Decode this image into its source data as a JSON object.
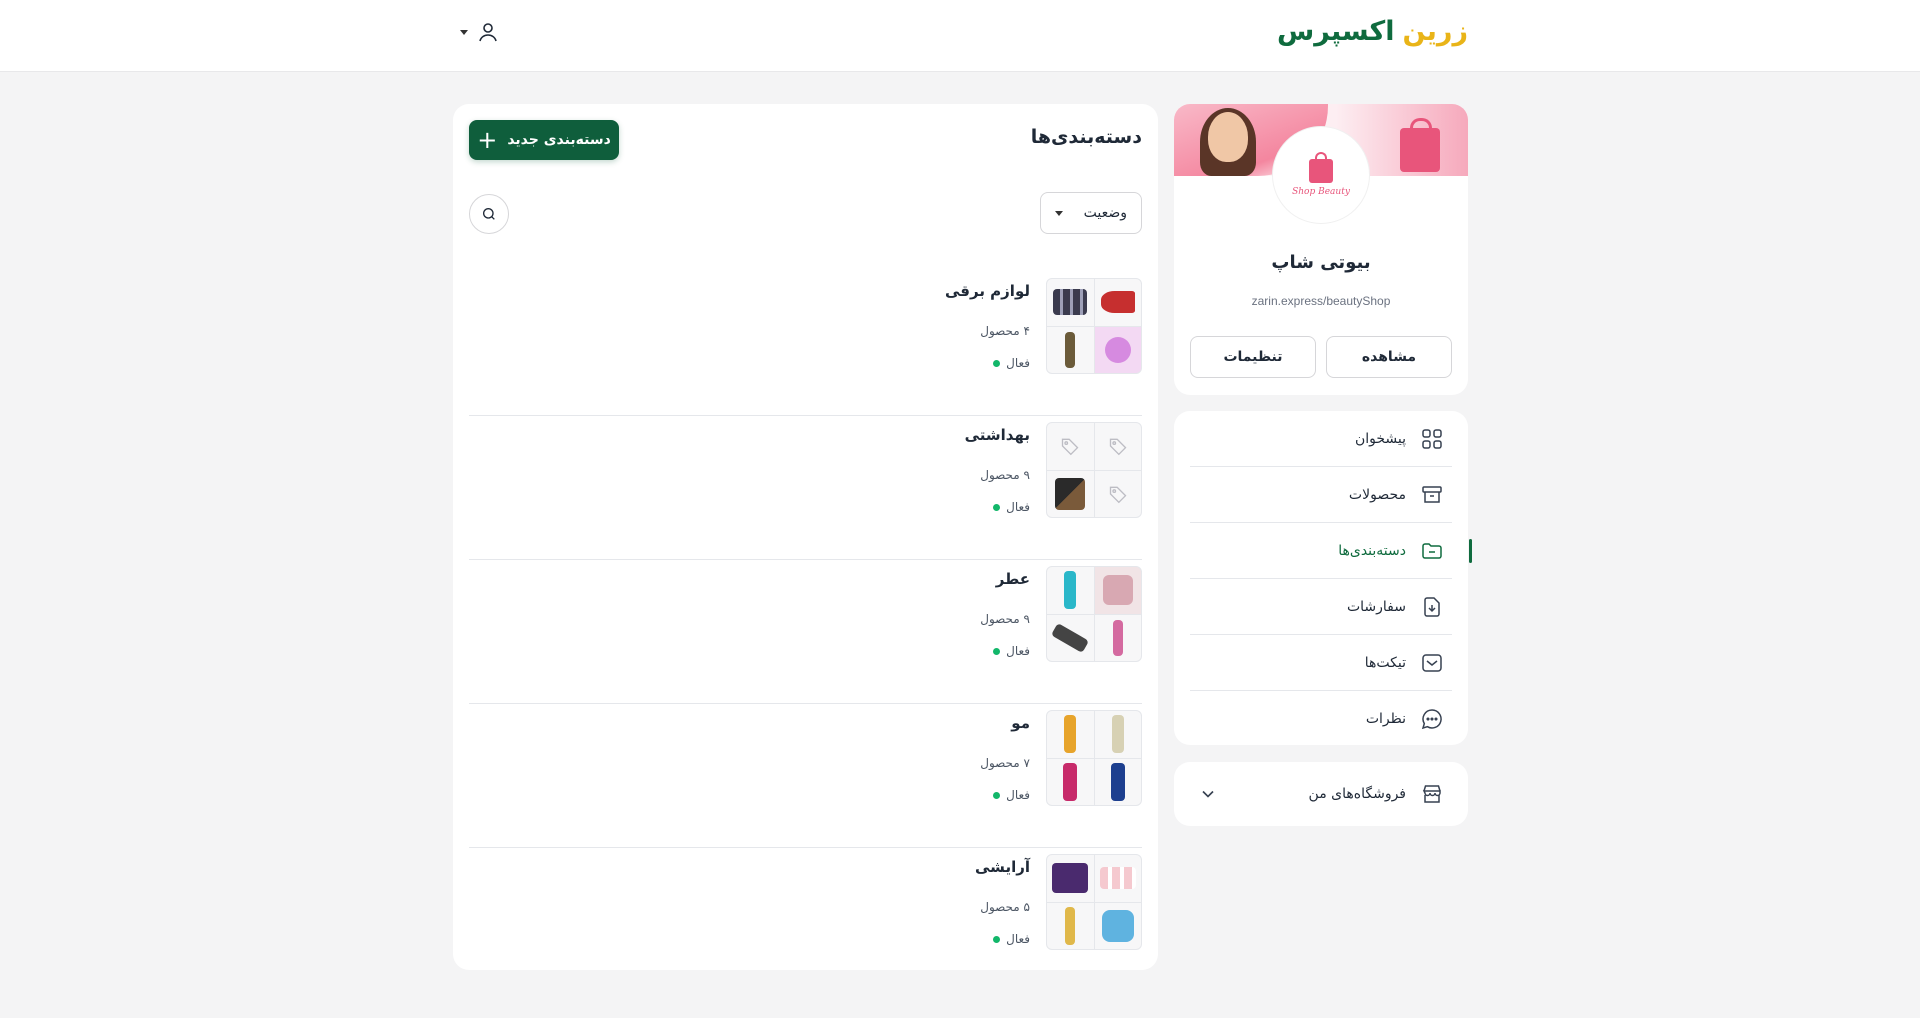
{
  "header": {
    "logo_part1": "زرین",
    "logo_part2": "اکسپرس",
    "user_icon": "user-icon",
    "colors": {
      "brand_green": "#0f6b3e",
      "brand_yellow": "#e9b418"
    }
  },
  "shop": {
    "banner_caption": "Shop Beauty",
    "name": "بیوتی شاپ",
    "url": "zarin.express/beautyShop",
    "view_label": "مشاهده",
    "settings_label": "تنظیمات"
  },
  "sidebar": {
    "items": [
      {
        "label": "پیشخوان",
        "icon": "dashboard-grid-icon",
        "active": false
      },
      {
        "label": "محصولات",
        "icon": "archive-box-icon",
        "active": false
      },
      {
        "label": "دسته‌بندی‌ها",
        "icon": "folder-icon",
        "active": true
      },
      {
        "label": "سفارشات",
        "icon": "download-document-icon",
        "active": false
      },
      {
        "label": "تیکت‌ها",
        "icon": "inbox-icon",
        "active": false
      },
      {
        "label": "نظرات",
        "icon": "chat-bubble-icon",
        "active": false
      }
    ],
    "my_stores_label": "فروشگاه‌های من"
  },
  "main": {
    "title": "دسته‌بندی‌ها",
    "new_button_label": "دسته‌بندی جدید",
    "status_filter_label": "وضعیت",
    "categories": [
      {
        "name": "لوازم برقی",
        "count": "۴ محصول",
        "status": "فعال"
      },
      {
        "name": "بهداشتی",
        "count": "۹ محصول",
        "status": "فعال"
      },
      {
        "name": "عطر",
        "count": "۹ محصول",
        "status": "فعال"
      },
      {
        "name": "مو",
        "count": "۷ محصول",
        "status": "فعال"
      },
      {
        "name": "آرایشی",
        "count": "۵ محصول",
        "status": "فعال"
      }
    ]
  }
}
